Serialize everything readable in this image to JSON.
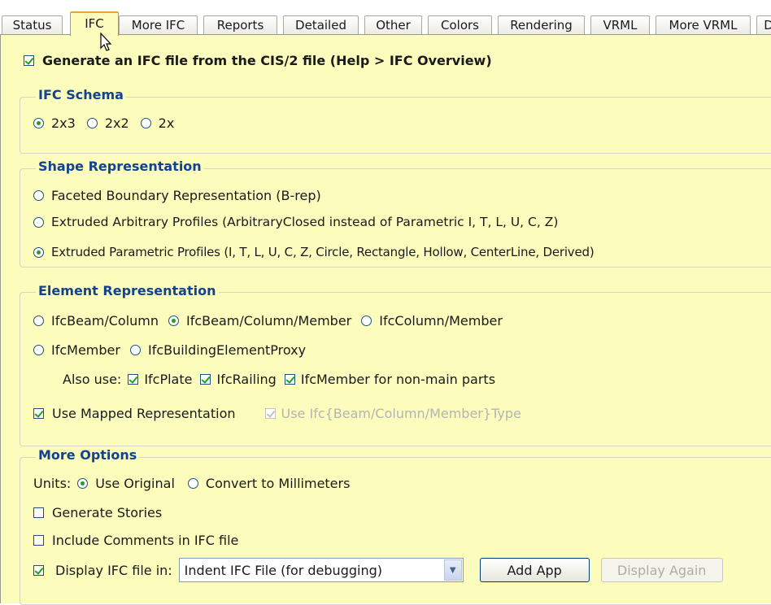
{
  "tabs": [
    "Status",
    "IFC",
    "More IFC",
    "Reports",
    "Detailed",
    "Other",
    "Colors",
    "Rendering",
    "VRML",
    "More VRML",
    "D"
  ],
  "active_tab": "IFC",
  "generate": {
    "label": "Generate an IFC file from the CIS/2 file (Help > IFC Overview)",
    "checked": true
  },
  "schema": {
    "title": "IFC Schema",
    "options": [
      "2x3",
      "2x2",
      "2x"
    ],
    "selected": "2x3"
  },
  "shape": {
    "title": "Shape Representation",
    "options": [
      "Faceted Boundary Representation (B-rep)",
      "Extruded Arbitrary Profiles (ArbitraryClosed instead of Parametric I, T, L, U, C, Z)",
      "Extruded Parametric Profiles (I, T, L, U, C, Z, Circle, Rectangle, Hollow, CenterLine, Derived)"
    ],
    "selected": 2
  },
  "element": {
    "title": "Element Representation",
    "options": [
      "IfcBeam/Column",
      "IfcBeam/Column/Member",
      "IfcColumn/Member",
      "IfcMember",
      "IfcBuildingElementProxy"
    ],
    "selected": "IfcBeam/Column/Member",
    "also_use_label": "Also use:",
    "also_use": [
      "IfcPlate",
      "IfcRailing",
      "IfcMember for non-main parts"
    ],
    "mapped_label": "Use Mapped Representation",
    "type_label": "Use Ifc{Beam/Column/Member}Type"
  },
  "more": {
    "title": "More Options",
    "units_label": "Units:",
    "units_options": [
      "Use Original",
      "Convert to Millimeters"
    ],
    "units_selected": "Use Original",
    "stories_label": "Generate Stories",
    "comments_label": "Include Comments in IFC file",
    "display_label": "Display IFC file in:",
    "display_value": "Indent IFC File (for debugging)",
    "add_app_label": "Add App",
    "display_again_label": "Display Again"
  },
  "colors": {
    "panel_bg": "#fcfcbc",
    "legend": "#13428f",
    "check": "#21a121",
    "active_tab_top": "#e8a33a"
  }
}
